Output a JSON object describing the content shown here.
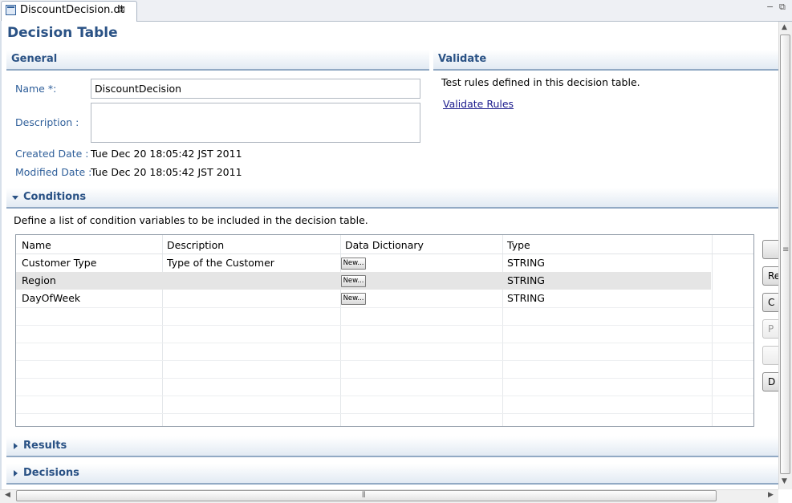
{
  "tab": {
    "label": "DiscountDecision.dt",
    "close_glyph": "⊠"
  },
  "window_controls": {
    "minimize": "−",
    "maximize": "⧉"
  },
  "page_title": "Decision Table",
  "general": {
    "title": "General",
    "name_label": "Name *:",
    "name_value": "DiscountDecision",
    "description_label": "Description :",
    "description_value": "",
    "created_label": "Created Date :",
    "created_value": "Tue Dec 20 18:05:42 JST 2011",
    "modified_label": "Modified Date :",
    "modified_value": "Tue Dec 20 18:05:42 JST 2011"
  },
  "validate": {
    "title": "Validate",
    "text": "Test rules defined in this decision table.",
    "link": "Validate Rules"
  },
  "conditions": {
    "title": "Conditions",
    "description": "Define a list of condition variables to be included in the decision table.",
    "columns": [
      "Name",
      "Description",
      "Data Dictionary",
      "Type"
    ],
    "rows": [
      {
        "name": "Customer Type",
        "description": "Type of the Customer",
        "dictionary": "New...",
        "type": "STRING"
      },
      {
        "name": "Region",
        "description": "",
        "dictionary": "New...",
        "type": "STRING"
      },
      {
        "name": "DayOfWeek",
        "description": "",
        "dictionary": "New...",
        "type": "STRING"
      }
    ],
    "side_buttons": [
      "",
      "Re",
      "C",
      "P",
      "",
      "D"
    ]
  },
  "results": {
    "title": "Results"
  },
  "decisions": {
    "title": "Decisions"
  },
  "scrollbar": {
    "grip": "≡",
    "hgrip": "⦀"
  },
  "colors": {
    "accent": "#2a5285",
    "selected_row": "#e5e5e5"
  }
}
